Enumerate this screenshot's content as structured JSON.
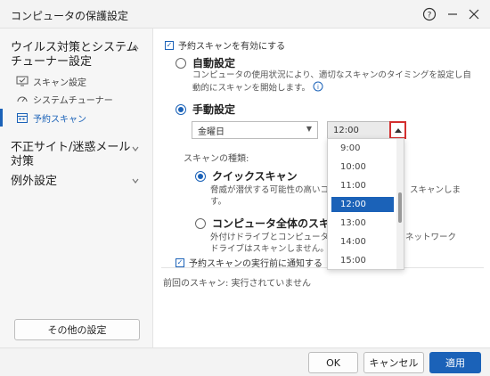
{
  "window": {
    "title": "コンピュータの保護設定"
  },
  "sidebar": {
    "categories": [
      {
        "label": "ウイルス対策とシステム\nチューナー設定"
      },
      {
        "label": "不正サイト/迷惑メール\n対策"
      },
      {
        "label": "例外設定"
      }
    ],
    "items": [
      {
        "label": "スキャン設定"
      },
      {
        "label": "システムチューナー"
      },
      {
        "label": "予約スキャン"
      }
    ],
    "other_settings": "その他の設定"
  },
  "main": {
    "enable_scheduled": "予約スキャンを有効にする",
    "auto": {
      "label": "自動設定",
      "desc": "コンピュータの使用状況により、適切なスキャンのタイミングを設定し自動的にスキャンを開始します。"
    },
    "manual": {
      "label": "手動設定"
    },
    "day_select": {
      "value": "金曜日"
    },
    "time_select": {
      "value": "12:00"
    },
    "time_options": [
      "9:00",
      "10:00",
      "11:00",
      "12:00",
      "13:00",
      "14:00",
      "15:00"
    ],
    "scan_type_label": "スキャンの種類:",
    "quick": {
      "label": "クイックスキャン",
      "desc": "脅威が潜伏する可能性の高いコン",
      "desc_tail": "スキャンしま",
      "desc_tail2": "す。"
    },
    "full": {
      "label": "コンピュータ全体のスキャ",
      "desc": "外付けドライブとコンピュータ全",
      "desc_tail": "ネットワーク",
      "desc2": "ドライブはスキャンしません。"
    },
    "notify": "予約スキャンの実行前に通知する",
    "last_scan": "前回のスキャン: 実行されていません"
  },
  "footer": {
    "ok": "OK",
    "cancel": "キャンセル",
    "apply": "適用"
  },
  "colors": {
    "accent": "#1b62b8",
    "highlight_border": "#d32f2f"
  }
}
